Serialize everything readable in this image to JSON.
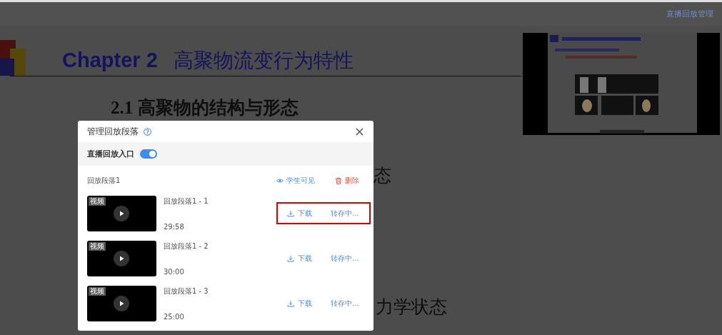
{
  "top_bar": {
    "title": "直播回放管理"
  },
  "slide": {
    "heading_latin": "Chapter 2",
    "heading_cjk": "高聚物流变行为特性",
    "lines": [
      {
        "text": "2.1  高聚物的结构与形态"
      },
      {
        "text": "态"
      },
      {
        "text": "力学状态"
      }
    ]
  },
  "dialog": {
    "title": "管理回放段落",
    "entry": {
      "label": "直播回放入口",
      "on": true
    },
    "sections": [
      {
        "title": "回放段落1",
        "visibility": "学生可见",
        "delete": "删除",
        "clips": [
          {
            "title": "回放段落1 - 1",
            "duration": "29:58",
            "badge": "视频",
            "download": "下载",
            "status": "转存中...",
            "highlighted": true
          },
          {
            "title": "回放段落1 - 2",
            "duration": "30:00",
            "badge": "视频",
            "download": "下载",
            "status": "转存中...",
            "highlighted": false
          },
          {
            "title": "回放段落1 - 3",
            "duration": "25:00",
            "badge": "视频",
            "download": "下载",
            "status": "转存中...",
            "highlighted": false
          }
        ]
      }
    ]
  }
}
